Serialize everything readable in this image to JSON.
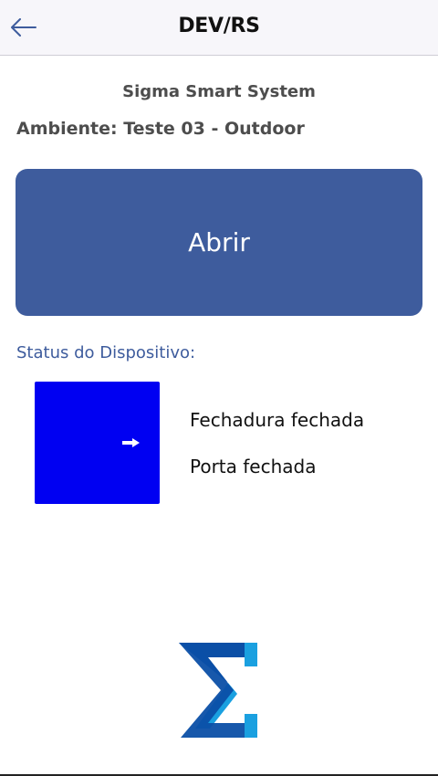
{
  "header": {
    "title": "DEV/RS",
    "back_icon": "arrow-left-icon"
  },
  "content": {
    "system_name": "Sigma Smart System",
    "ambiente": "Ambiente: Teste 03 - Outdoor",
    "open_button_label": "Abrir",
    "status_label": "Status do Dispositivo:",
    "lock_status": "Fechadura fechada",
    "door_status": "Porta fechada"
  },
  "colors": {
    "accent": "#3e5c9d",
    "status_indicator": "#0000f2",
    "logo_dark": "#0b4fa6",
    "logo_light": "#1aa0e0"
  },
  "icons": {
    "status_arrow": "arrow-right-icon",
    "logo": "sigma-logo-icon"
  }
}
